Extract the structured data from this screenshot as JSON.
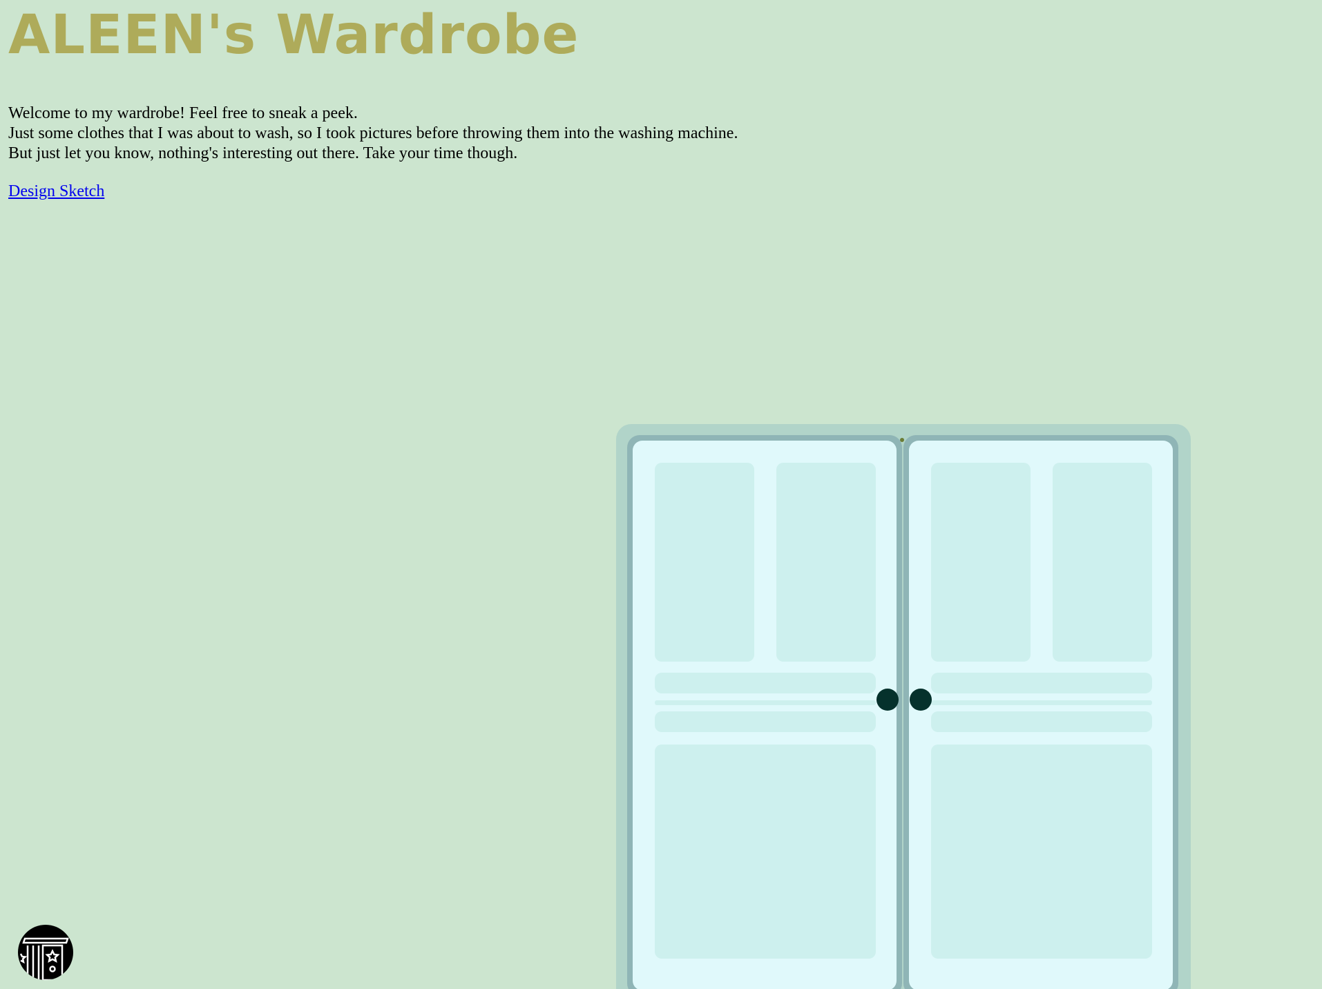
{
  "header": {
    "title": "ALEEN's Wardrobe"
  },
  "intro": {
    "lines": [
      "Welcome to my wardrobe! Feel free to sneak a peek.",
      "Just some clothes that I was about to wash, so I took pictures before throwing them into the washing machine.",
      "But just let you know, nothing's interesting out there. Take your time though."
    ]
  },
  "links": {
    "design_sketch": "Design Sketch"
  },
  "wardrobe": {
    "doors": [
      "left-door",
      "right-door"
    ],
    "knob_color": "#05312c"
  },
  "logo": {
    "icon": "wardrobe-logo-icon"
  },
  "colors": {
    "background": "#cce5cf",
    "title": "#aeab5a",
    "link": "#0000ee",
    "wardrobe_frame": "#b1d4c9",
    "door_border": "#8fb5b6",
    "door_face": "#e0f9fb",
    "panel": "#cdf0ee"
  }
}
